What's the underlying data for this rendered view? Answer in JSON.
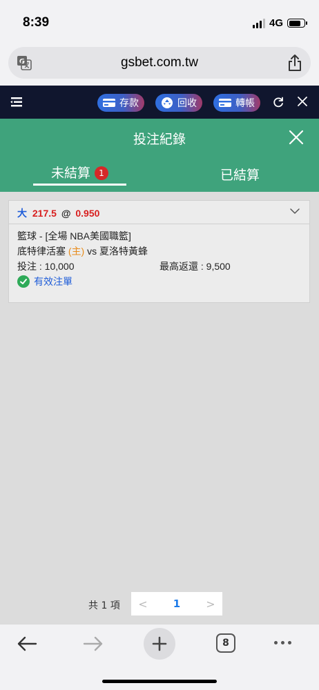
{
  "status_bar": {
    "time": "8:39",
    "network": "4G"
  },
  "browser": {
    "url": "gsbet.com.tw"
  },
  "app_bar": {
    "deposit_label": "存款",
    "recycle_label": "回收",
    "transfer_label": "轉帳"
  },
  "page": {
    "title": "投注紀錄"
  },
  "tabs": {
    "unsettled": {
      "label": "未結算",
      "badge": "1"
    },
    "settled": {
      "label": "已結算"
    }
  },
  "bet": {
    "side": "大",
    "line": "217.5",
    "at": "@",
    "odds": "0.950",
    "league": "籃球 - [全場 NBA美國職籃]",
    "home_team": "底特律活塞",
    "home_tag": "(主)",
    "vs": "vs",
    "away_team": "夏洛特黃蜂",
    "stake": "投注 : 10,000",
    "max_return": "最高返還 : 9,500",
    "status": "有效注單"
  },
  "pagination": {
    "total": "共 1 項",
    "current": "1",
    "prev": "<",
    "next": ">"
  },
  "toolbar": {
    "tab_count": "8"
  },
  "colors": {
    "accent_green": "#3fa37c",
    "app_bar_bg": "#10162e",
    "odds_red": "#d81e1e",
    "link_blue": "#1e5cd8",
    "home_orange": "#e88b1a"
  }
}
